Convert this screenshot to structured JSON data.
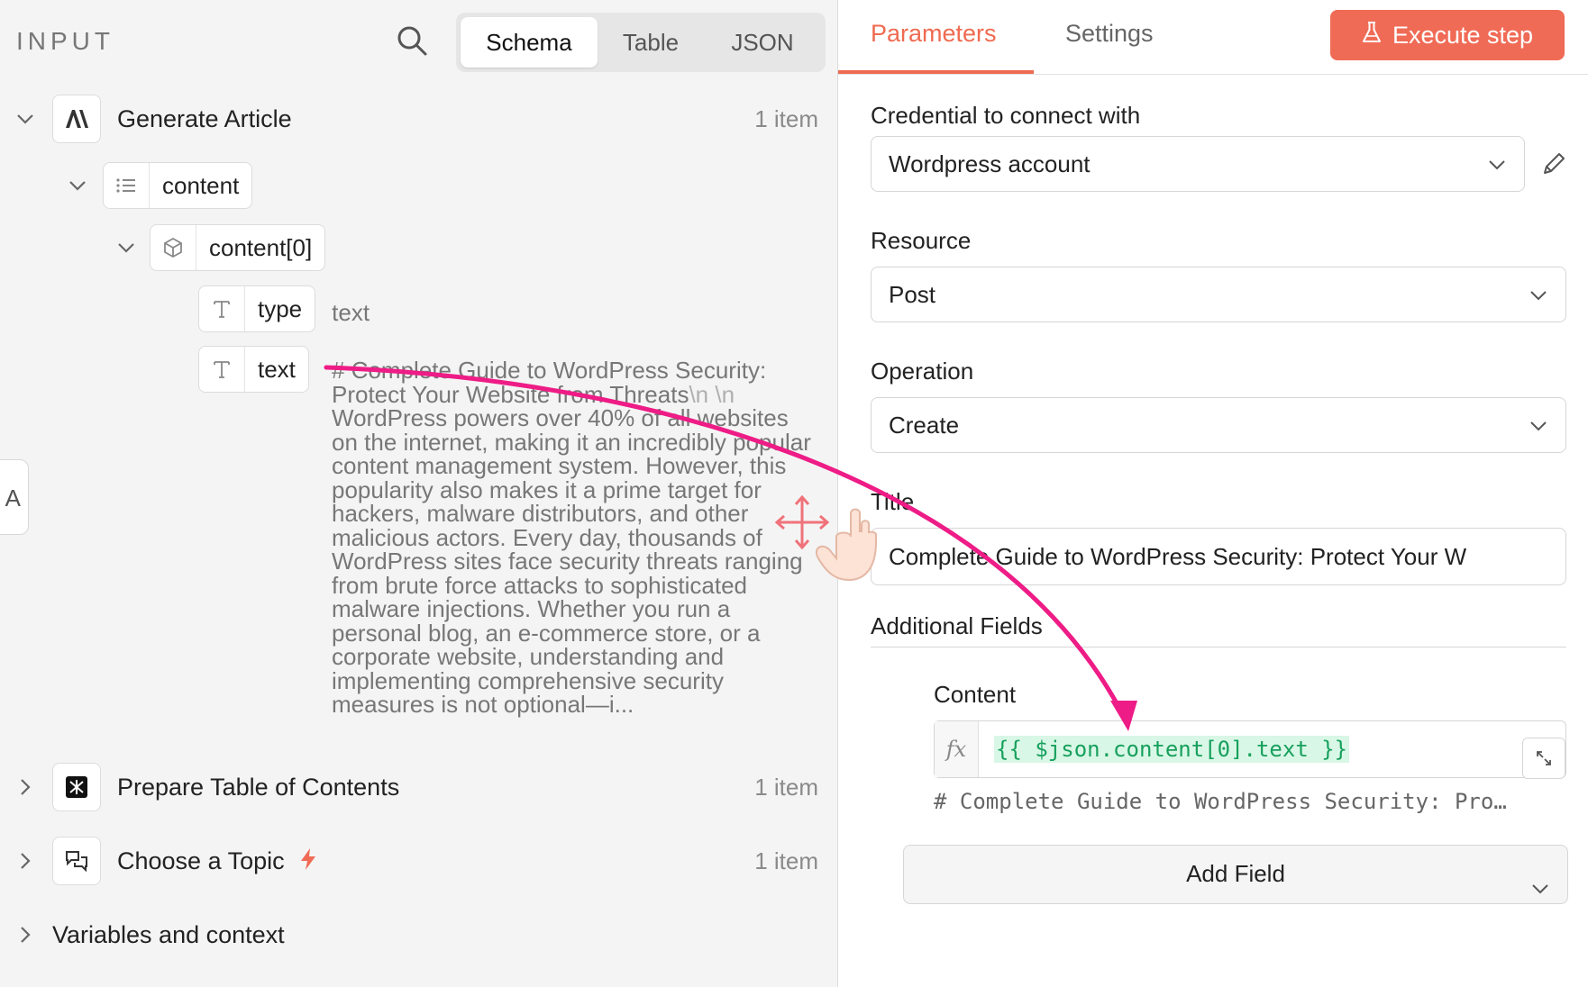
{
  "input_panel": {
    "label": "INPUT",
    "view_tabs": [
      "Schema",
      "Table",
      "JSON"
    ],
    "active_view": "Schema",
    "nodes": {
      "generate_article": {
        "title": "Generate Article",
        "count": "1 item"
      },
      "content": {
        "label": "content"
      },
      "content0": {
        "label": "content[0]"
      },
      "type_field": {
        "label": "type",
        "value": "text"
      },
      "text_field": {
        "label": "text"
      },
      "prepare_toc": {
        "title": "Prepare Table of Contents",
        "count": "1 item"
      },
      "choose_topic": {
        "title": "Choose a Topic",
        "count": "1 item"
      },
      "variables": {
        "title": "Variables and context"
      }
    },
    "text_preview": {
      "part1": "# Complete Guide to WordPress Security: Protect Your Website from Threats",
      "escape1": "\\n",
      "escape2": "\\n",
      "part2": "WordPress powers over 40% of all websites on the internet, making it an incredibly popular content management system. However, this popularity also makes it a prime target for hackers, malware distributors, and other malicious actors. Every day, thousands of WordPress sites face security threats ranging from brute force attacks to sophisticated malware injections. Whether you run a personal blog, an e-commerce store, or a corporate website, understanding and implementing comprehensive security measures is not optional—i..."
    },
    "side_tab_glyph": "A"
  },
  "params_panel": {
    "tabs": {
      "parameters": "Parameters",
      "settings": "Settings"
    },
    "execute_label": "Execute step",
    "credential": {
      "label": "Credential to connect with",
      "value": "Wordpress account"
    },
    "resource": {
      "label": "Resource",
      "value": "Post"
    },
    "operation": {
      "label": "Operation",
      "value": "Create"
    },
    "title_field": {
      "label": "Title",
      "value": "Complete Guide to WordPress Security: Protect Your W"
    },
    "additional_fields": {
      "heading": "Additional Fields",
      "content_label": "Content",
      "fx": "fx",
      "expression": "{{ $json.content[0].text }}",
      "preview": "# Complete Guide to WordPress Security: Pro…"
    },
    "add_field_label": "Add Field"
  },
  "colors": {
    "accent": "#f06b56",
    "expression_green": "#17a05d",
    "drag_arrow": "#ee1c86"
  },
  "icons": [
    "search-icon",
    "chevron-down-icon",
    "chevron-right-icon",
    "anthropic-icon",
    "list-icon",
    "cube-icon",
    "text-type-icon",
    "n8n-node-icon",
    "chat-icon",
    "lightning-icon",
    "flask-icon",
    "pencil-icon",
    "expand-icon",
    "move-icon",
    "hand-cursor-icon"
  ]
}
